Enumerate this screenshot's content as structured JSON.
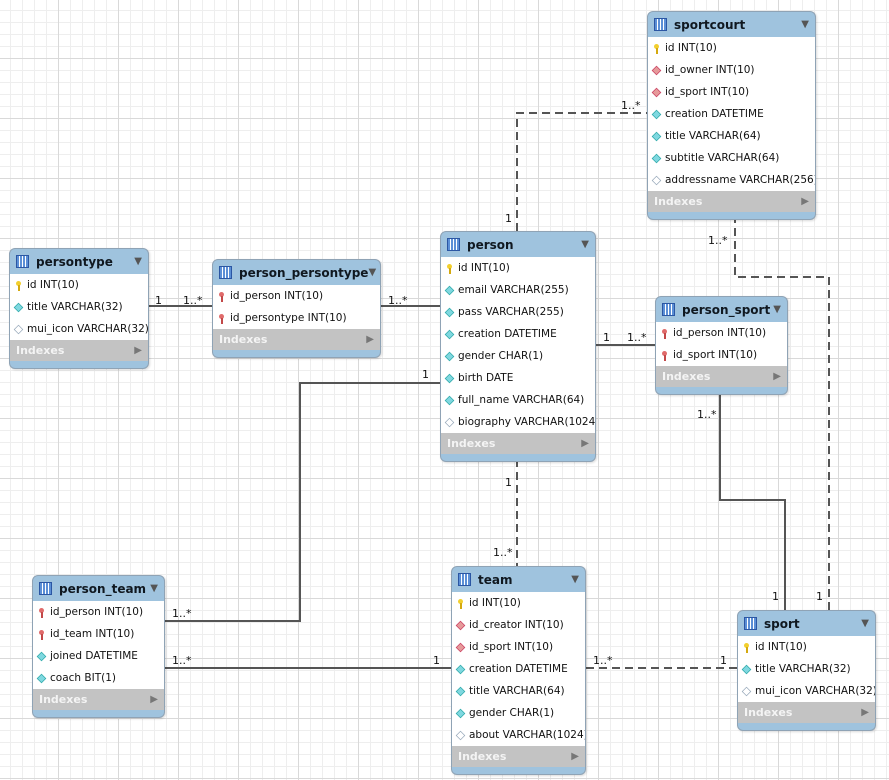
{
  "tables": [
    {
      "name": "sportcourt",
      "indexes": "Indexes",
      "columns": [
        {
          "icon": "pk",
          "text": "id INT(10)"
        },
        {
          "icon": "fk",
          "text": "id_owner INT(10)"
        },
        {
          "icon": "fk",
          "text": "id_sport INT(10)"
        },
        {
          "icon": "nn",
          "text": "creation DATETIME"
        },
        {
          "icon": "nn",
          "text": "title VARCHAR(64)"
        },
        {
          "icon": "nn",
          "text": "subtitle VARCHAR(64)"
        },
        {
          "icon": "null",
          "text": "addressname VARCHAR(256)"
        }
      ]
    },
    {
      "name": "persontype",
      "indexes": "Indexes",
      "columns": [
        {
          "icon": "pk",
          "text": "id INT(10)"
        },
        {
          "icon": "nn",
          "text": "title VARCHAR(32)"
        },
        {
          "icon": "null",
          "text": "mui_icon VARCHAR(32)"
        }
      ]
    },
    {
      "name": "person_persontype",
      "indexes": "Indexes",
      "columns": [
        {
          "icon": "pkfk",
          "text": "id_person INT(10)"
        },
        {
          "icon": "pkfk",
          "text": "id_persontype INT(10)"
        }
      ]
    },
    {
      "name": "person",
      "indexes": "Indexes",
      "columns": [
        {
          "icon": "pk",
          "text": "id INT(10)"
        },
        {
          "icon": "nn",
          "text": "email VARCHAR(255)"
        },
        {
          "icon": "nn",
          "text": "pass VARCHAR(255)"
        },
        {
          "icon": "nn",
          "text": "creation DATETIME"
        },
        {
          "icon": "nn",
          "text": "gender CHAR(1)"
        },
        {
          "icon": "nn",
          "text": "birth DATE"
        },
        {
          "icon": "nn",
          "text": "full_name VARCHAR(64)"
        },
        {
          "icon": "null",
          "text": "biography VARCHAR(1024)"
        }
      ]
    },
    {
      "name": "person_sport",
      "indexes": "Indexes",
      "columns": [
        {
          "icon": "pkfk",
          "text": "id_person INT(10)"
        },
        {
          "icon": "pkfk",
          "text": "id_sport INT(10)"
        }
      ]
    },
    {
      "name": "person_team",
      "indexes": "Indexes",
      "columns": [
        {
          "icon": "pkfk",
          "text": "id_person INT(10)"
        },
        {
          "icon": "pkfk",
          "text": "id_team INT(10)"
        },
        {
          "icon": "nn",
          "text": "joined DATETIME"
        },
        {
          "icon": "nn",
          "text": "coach BIT(1)"
        }
      ]
    },
    {
      "name": "team",
      "indexes": "Indexes",
      "columns": [
        {
          "icon": "pk",
          "text": "id INT(10)"
        },
        {
          "icon": "fk",
          "text": "id_creator INT(10)"
        },
        {
          "icon": "fk",
          "text": "id_sport INT(10)"
        },
        {
          "icon": "nn",
          "text": "creation DATETIME"
        },
        {
          "icon": "nn",
          "text": "title VARCHAR(64)"
        },
        {
          "icon": "nn",
          "text": "gender CHAR(1)"
        },
        {
          "icon": "null",
          "text": "about VARCHAR(1024)"
        }
      ]
    },
    {
      "name": "sport",
      "indexes": "Indexes",
      "columns": [
        {
          "icon": "pk",
          "text": "id INT(10)"
        },
        {
          "icon": "nn",
          "text": "title VARCHAR(32)"
        },
        {
          "icon": "null",
          "text": "mui_icon VARCHAR(32)"
        }
      ]
    }
  ],
  "relationships": [
    {
      "from": "persontype",
      "to": "person_persontype",
      "style": "solid",
      "from_card": "1",
      "to_card": "1..*"
    },
    {
      "from": "person",
      "to": "person_persontype",
      "style": "solid",
      "to_card": "1..*"
    },
    {
      "from": "person",
      "to": "person_sport",
      "style": "solid",
      "from_card": "1",
      "to_card": "1..*"
    },
    {
      "from": "person",
      "to": "person_team",
      "style": "solid",
      "from_card": "1",
      "to_card": "1..*"
    },
    {
      "from": "team",
      "to": "person_team",
      "style": "solid",
      "from_card": "1",
      "to_card": "1..*"
    },
    {
      "from": "person",
      "to": "team",
      "style": "dashed",
      "from_card": "1",
      "to_card": "1..*"
    },
    {
      "from": "person",
      "to": "sportcourt",
      "style": "dashed",
      "from_card": "1",
      "to_card": "1..*"
    },
    {
      "from": "sport",
      "to": "team",
      "style": "dashed",
      "from_card": "1",
      "to_card": "1..*"
    },
    {
      "from": "sport",
      "to": "person_sport",
      "style": "solid",
      "from_card": "1",
      "to_card": "1..*"
    },
    {
      "from": "sport",
      "to": "sportcourt",
      "style": "dashed",
      "from_card": "1",
      "to_card": "1..*"
    }
  ],
  "colors": {
    "header": "#9fc3de",
    "indexes": "#c3c3c3",
    "line": "#555555"
  }
}
